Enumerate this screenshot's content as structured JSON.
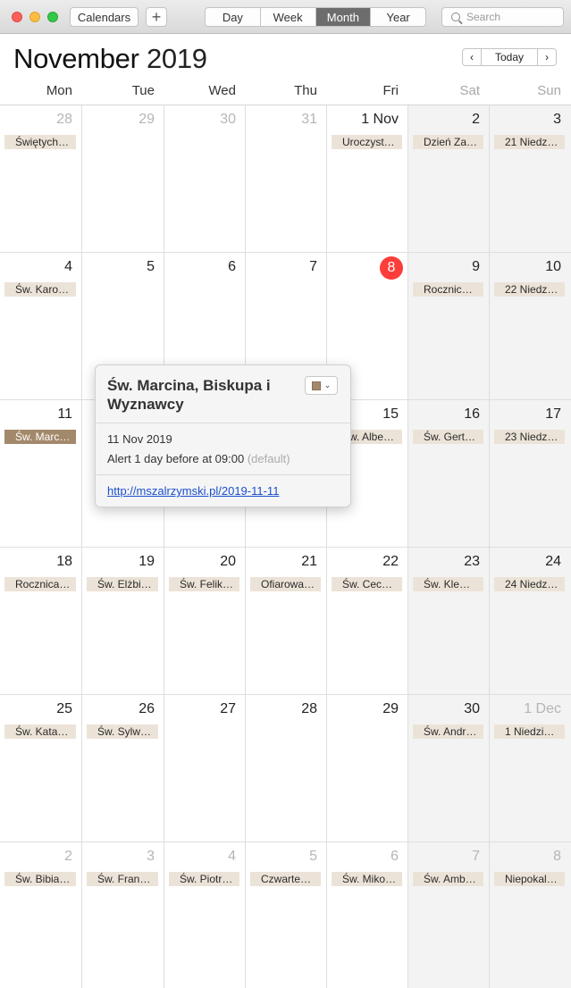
{
  "toolbar": {
    "calendars_label": "Calendars",
    "add_label": "+",
    "views": [
      "Day",
      "Week",
      "Month",
      "Year"
    ],
    "active_view": "Month",
    "search_placeholder": "Search"
  },
  "header": {
    "month": "November",
    "year": "2019",
    "today_label": "Today",
    "prev_label": "‹",
    "next_label": "›"
  },
  "weekdays": [
    "Mon",
    "Tue",
    "Wed",
    "Thu",
    "Fri",
    "Sat",
    "Sun"
  ],
  "weeks": [
    [
      {
        "label": "28",
        "dim": true,
        "event": "Świętych…"
      },
      {
        "label": "29",
        "dim": true
      },
      {
        "label": "30",
        "dim": true
      },
      {
        "label": "31",
        "dim": true
      },
      {
        "label": "1 Nov",
        "event": "Uroczyst…"
      },
      {
        "label": "2",
        "event": "Dzień Za…"
      },
      {
        "label": "3",
        "event": "21 Niedzi…"
      }
    ],
    [
      {
        "label": "4",
        "event": "Św. Karol…"
      },
      {
        "label": "5"
      },
      {
        "label": "6"
      },
      {
        "label": "7"
      },
      {
        "label": "8",
        "today": true
      },
      {
        "label": "9",
        "event": "Rocznica…"
      },
      {
        "label": "10",
        "event": "22 Niedz…"
      }
    ],
    [
      {
        "label": "11",
        "event": "Św. Marc…",
        "selected": true
      },
      {
        "label": "12"
      },
      {
        "label": "13"
      },
      {
        "label": "14"
      },
      {
        "label": "15",
        "event": "Św. Albe…"
      },
      {
        "label": "16",
        "event": "Św. Gert…"
      },
      {
        "label": "17",
        "event": "23 Niedz…"
      }
    ],
    [
      {
        "label": "18",
        "event": "Rocznica…"
      },
      {
        "label": "19",
        "event": "Św. Elżbi…"
      },
      {
        "label": "20",
        "event": "Św. Felik…"
      },
      {
        "label": "21",
        "event": "Ofiarowa…"
      },
      {
        "label": "22",
        "event": "Św. Cecy…"
      },
      {
        "label": "23",
        "event": "Św. Klem…"
      },
      {
        "label": "24",
        "event": "24 Niedz…"
      }
    ],
    [
      {
        "label": "25",
        "event": "Św. Katar…"
      },
      {
        "label": "26",
        "event": "Św. Sylw…"
      },
      {
        "label": "27"
      },
      {
        "label": "28"
      },
      {
        "label": "29"
      },
      {
        "label": "30",
        "event": "Św. Andr…"
      },
      {
        "label": "1 Dec",
        "dim": true,
        "event": "1 Niedzie…"
      }
    ],
    [
      {
        "label": "2",
        "dim": true,
        "event": "Św. Bibia…"
      },
      {
        "label": "3",
        "dim": true,
        "event": "Św. Fran…"
      },
      {
        "label": "4",
        "dim": true,
        "event": "Św. Piotr…"
      },
      {
        "label": "5",
        "dim": true,
        "event": "Czwarte…"
      },
      {
        "label": "6",
        "dim": true,
        "event": "Św. Miko…"
      },
      {
        "label": "7",
        "dim": true,
        "event": "Św. Amb…"
      },
      {
        "label": "8",
        "dim": true,
        "event": "Niepokal…"
      }
    ]
  ],
  "popover": {
    "title": "Św. Marcina, Biskupa i Wyznawcy",
    "date": "11 Nov 2019",
    "alert": "Alert 1 day before at 09:00",
    "alert_default": "(default)",
    "link": "http://mszalrzymski.pl/2019-11-11",
    "calendar_color": "#a3896b"
  },
  "colors": {
    "today": "#fc3d39",
    "event_bg": "#ece3d8",
    "selected_event_bg": "#a3896b",
    "weekend_bg": "#f3f3f3"
  }
}
